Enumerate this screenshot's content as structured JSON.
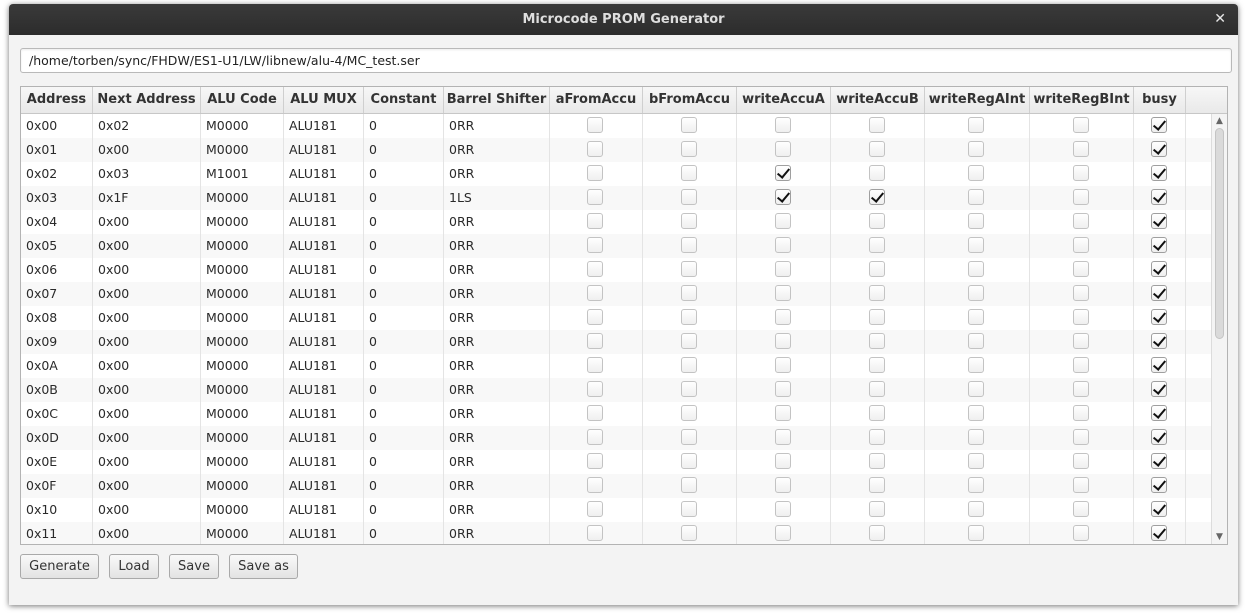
{
  "window": {
    "title": "Microcode PROM Generator",
    "close_glyph": "✕"
  },
  "file_path": "/home/torben/sync/FHDW/ES1-U1/LW/libnew/alu-4/MC_test.ser",
  "table": {
    "columns": [
      "Address",
      "Next Address",
      "ALU Code",
      "ALU MUX",
      "Constant",
      "Barrel Shifter",
      "aFromAccu",
      "bFromAccu",
      "writeAccuA",
      "writeAccuB",
      "writeRegAInt",
      "writeRegBInt",
      "busy"
    ],
    "rows": [
      {
        "address": "0x00",
        "next_address": "0x02",
        "alu_code": "M0000",
        "alu_mux": "ALU181",
        "constant": "0",
        "barrel_shifter": "0RR",
        "aFromAccu": false,
        "bFromAccu": false,
        "writeAccuA": false,
        "writeAccuB": false,
        "writeRegAInt": false,
        "writeRegBInt": false,
        "busy": true
      },
      {
        "address": "0x01",
        "next_address": "0x00",
        "alu_code": "M0000",
        "alu_mux": "ALU181",
        "constant": "0",
        "barrel_shifter": "0RR",
        "aFromAccu": false,
        "bFromAccu": false,
        "writeAccuA": false,
        "writeAccuB": false,
        "writeRegAInt": false,
        "writeRegBInt": false,
        "busy": true
      },
      {
        "address": "0x02",
        "next_address": "0x03",
        "alu_code": "M1001",
        "alu_mux": "ALU181",
        "constant": "0",
        "barrel_shifter": "0RR",
        "aFromAccu": false,
        "bFromAccu": false,
        "writeAccuA": true,
        "writeAccuB": false,
        "writeRegAInt": false,
        "writeRegBInt": false,
        "busy": true
      },
      {
        "address": "0x03",
        "next_address": "0x1F",
        "alu_code": "M0000",
        "alu_mux": "ALU181",
        "constant": "0",
        "barrel_shifter": "1LS",
        "aFromAccu": false,
        "bFromAccu": false,
        "writeAccuA": true,
        "writeAccuB": true,
        "writeRegAInt": false,
        "writeRegBInt": false,
        "busy": true
      },
      {
        "address": "0x04",
        "next_address": "0x00",
        "alu_code": "M0000",
        "alu_mux": "ALU181",
        "constant": "0",
        "barrel_shifter": "0RR",
        "aFromAccu": false,
        "bFromAccu": false,
        "writeAccuA": false,
        "writeAccuB": false,
        "writeRegAInt": false,
        "writeRegBInt": false,
        "busy": true
      },
      {
        "address": "0x05",
        "next_address": "0x00",
        "alu_code": "M0000",
        "alu_mux": "ALU181",
        "constant": "0",
        "barrel_shifter": "0RR",
        "aFromAccu": false,
        "bFromAccu": false,
        "writeAccuA": false,
        "writeAccuB": false,
        "writeRegAInt": false,
        "writeRegBInt": false,
        "busy": true
      },
      {
        "address": "0x06",
        "next_address": "0x00",
        "alu_code": "M0000",
        "alu_mux": "ALU181",
        "constant": "0",
        "barrel_shifter": "0RR",
        "aFromAccu": false,
        "bFromAccu": false,
        "writeAccuA": false,
        "writeAccuB": false,
        "writeRegAInt": false,
        "writeRegBInt": false,
        "busy": true
      },
      {
        "address": "0x07",
        "next_address": "0x00",
        "alu_code": "M0000",
        "alu_mux": "ALU181",
        "constant": "0",
        "barrel_shifter": "0RR",
        "aFromAccu": false,
        "bFromAccu": false,
        "writeAccuA": false,
        "writeAccuB": false,
        "writeRegAInt": false,
        "writeRegBInt": false,
        "busy": true
      },
      {
        "address": "0x08",
        "next_address": "0x00",
        "alu_code": "M0000",
        "alu_mux": "ALU181",
        "constant": "0",
        "barrel_shifter": "0RR",
        "aFromAccu": false,
        "bFromAccu": false,
        "writeAccuA": false,
        "writeAccuB": false,
        "writeRegAInt": false,
        "writeRegBInt": false,
        "busy": true
      },
      {
        "address": "0x09",
        "next_address": "0x00",
        "alu_code": "M0000",
        "alu_mux": "ALU181",
        "constant": "0",
        "barrel_shifter": "0RR",
        "aFromAccu": false,
        "bFromAccu": false,
        "writeAccuA": false,
        "writeAccuB": false,
        "writeRegAInt": false,
        "writeRegBInt": false,
        "busy": true
      },
      {
        "address": "0x0A",
        "next_address": "0x00",
        "alu_code": "M0000",
        "alu_mux": "ALU181",
        "constant": "0",
        "barrel_shifter": "0RR",
        "aFromAccu": false,
        "bFromAccu": false,
        "writeAccuA": false,
        "writeAccuB": false,
        "writeRegAInt": false,
        "writeRegBInt": false,
        "busy": true
      },
      {
        "address": "0x0B",
        "next_address": "0x00",
        "alu_code": "M0000",
        "alu_mux": "ALU181",
        "constant": "0",
        "barrel_shifter": "0RR",
        "aFromAccu": false,
        "bFromAccu": false,
        "writeAccuA": false,
        "writeAccuB": false,
        "writeRegAInt": false,
        "writeRegBInt": false,
        "busy": true
      },
      {
        "address": "0x0C",
        "next_address": "0x00",
        "alu_code": "M0000",
        "alu_mux": "ALU181",
        "constant": "0",
        "barrel_shifter": "0RR",
        "aFromAccu": false,
        "bFromAccu": false,
        "writeAccuA": false,
        "writeAccuB": false,
        "writeRegAInt": false,
        "writeRegBInt": false,
        "busy": true
      },
      {
        "address": "0x0D",
        "next_address": "0x00",
        "alu_code": "M0000",
        "alu_mux": "ALU181",
        "constant": "0",
        "barrel_shifter": "0RR",
        "aFromAccu": false,
        "bFromAccu": false,
        "writeAccuA": false,
        "writeAccuB": false,
        "writeRegAInt": false,
        "writeRegBInt": false,
        "busy": true
      },
      {
        "address": "0x0E",
        "next_address": "0x00",
        "alu_code": "M0000",
        "alu_mux": "ALU181",
        "constant": "0",
        "barrel_shifter": "0RR",
        "aFromAccu": false,
        "bFromAccu": false,
        "writeAccuA": false,
        "writeAccuB": false,
        "writeRegAInt": false,
        "writeRegBInt": false,
        "busy": true
      },
      {
        "address": "0x0F",
        "next_address": "0x00",
        "alu_code": "M0000",
        "alu_mux": "ALU181",
        "constant": "0",
        "barrel_shifter": "0RR",
        "aFromAccu": false,
        "bFromAccu": false,
        "writeAccuA": false,
        "writeAccuB": false,
        "writeRegAInt": false,
        "writeRegBInt": false,
        "busy": true
      },
      {
        "address": "0x10",
        "next_address": "0x00",
        "alu_code": "M0000",
        "alu_mux": "ALU181",
        "constant": "0",
        "barrel_shifter": "0RR",
        "aFromAccu": false,
        "bFromAccu": false,
        "writeAccuA": false,
        "writeAccuB": false,
        "writeRegAInt": false,
        "writeRegBInt": false,
        "busy": true
      },
      {
        "address": "0x11",
        "next_address": "0x00",
        "alu_code": "M0000",
        "alu_mux": "ALU181",
        "constant": "0",
        "barrel_shifter": "0RR",
        "aFromAccu": false,
        "bFromAccu": false,
        "writeAccuA": false,
        "writeAccuB": false,
        "writeRegAInt": false,
        "writeRegBInt": false,
        "busy": true
      }
    ],
    "scroll_up_glyph": "▲",
    "scroll_down_glyph": "▼"
  },
  "buttons": {
    "generate": "Generate",
    "load": "Load",
    "save": "Save",
    "save_as": "Save as"
  }
}
